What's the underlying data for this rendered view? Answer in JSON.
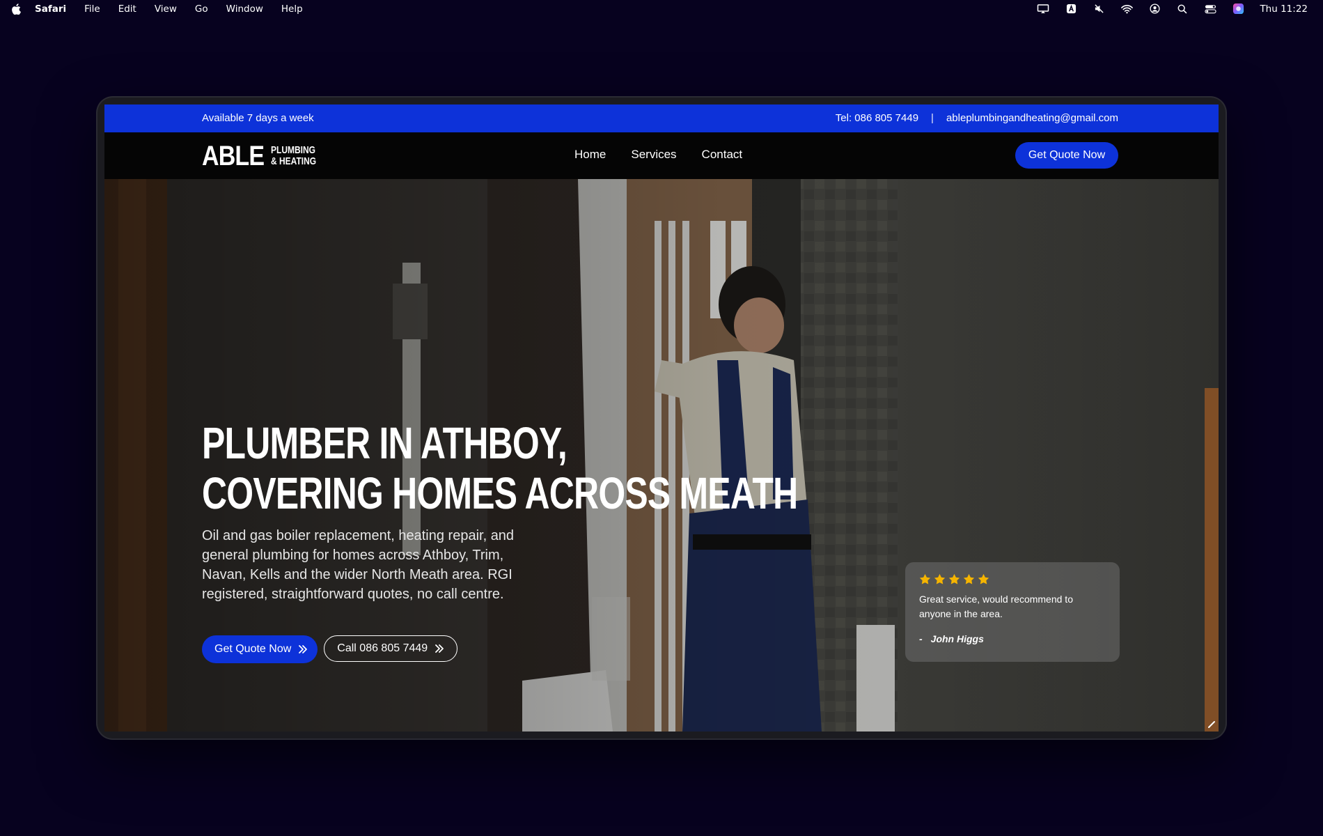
{
  "menubar": {
    "app_name": "Safari",
    "menus": [
      "File",
      "Edit",
      "View",
      "Go",
      "Window",
      "Help"
    ],
    "clock": "Thu 11:22",
    "status_icons": [
      "airplay-icon",
      "keyboard-input-icon",
      "mute-icon",
      "wifi-icon",
      "user-icon",
      "search-icon",
      "control-center-icon",
      "siri-icon"
    ]
  },
  "infobar": {
    "availability": "Available 7 days a week",
    "phone": "Tel: 086 805 7449",
    "separator": "|",
    "email": "ableplumbingandheating@gmail.com"
  },
  "nav": {
    "logo_main": "ABLE",
    "logo_line1": "PLUMBING",
    "logo_line2": "& HEATING",
    "links": [
      "Home",
      "Services",
      "Contact"
    ],
    "cta": "Get Quote Now"
  },
  "hero": {
    "title_line1": "PLUMBER IN ATHBOY,",
    "title_line2": "COVERING HOMES ACROSS MEATH",
    "description": "Oil and gas boiler replacement, heating repair, and general plumbing for homes across Athboy, Trim, Navan, Kells and the wider North Meath area. RGI registered, straightforward quotes, no call centre.",
    "primary_button": "Get Quote Now",
    "secondary_button": "Call 086 805 7449"
  },
  "review": {
    "rating": 5,
    "text": "Great service, would recommend to anyone in the area.",
    "dash": "-",
    "author": "John Higgs"
  },
  "colors": {
    "brand_blue": "#0d32d9",
    "star": "#f5b400",
    "page_background": "#07021f"
  }
}
